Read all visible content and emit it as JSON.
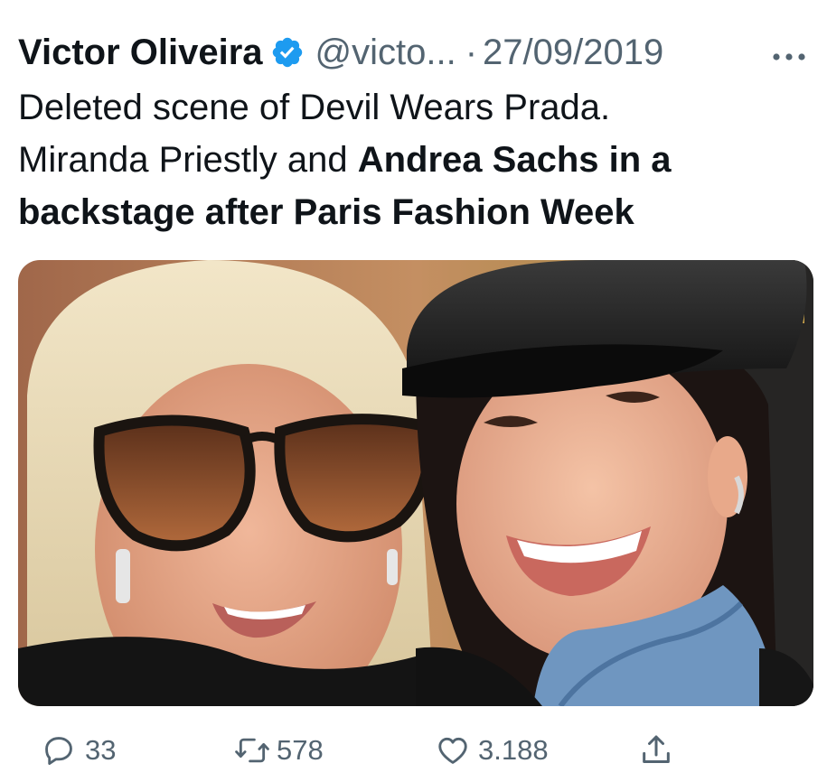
{
  "tweet": {
    "display_name": "Victor Oliveira",
    "handle": "@victo...",
    "separator": "·",
    "date": "27/09/2019",
    "text_line1": "Deleted scene of Devil Wears Prada.",
    "text_line2_regular": "Miranda Priestly and ",
    "text_line2_bold": "Andrea Sachs in a",
    "text_line3_bold": "backstage after Paris Fashion Week"
  },
  "media": {
    "alt": "Selfie of two women: a blonde woman in dark cat-eye sunglasses and a smiling woman wearing a black leather cap"
  },
  "actions": {
    "replies": "33",
    "retweets": "578",
    "likes": "3.188"
  },
  "icons": {
    "verified": "verified-badge-icon",
    "more": "more-dots-icon",
    "reply": "reply-bubble-icon",
    "retweet": "retweet-arrows-icon",
    "like": "heart-icon",
    "share": "share-upload-icon"
  },
  "colors": {
    "text_primary": "#0f1419",
    "text_secondary": "#536471",
    "verified_blue": "#1d9bf0"
  }
}
